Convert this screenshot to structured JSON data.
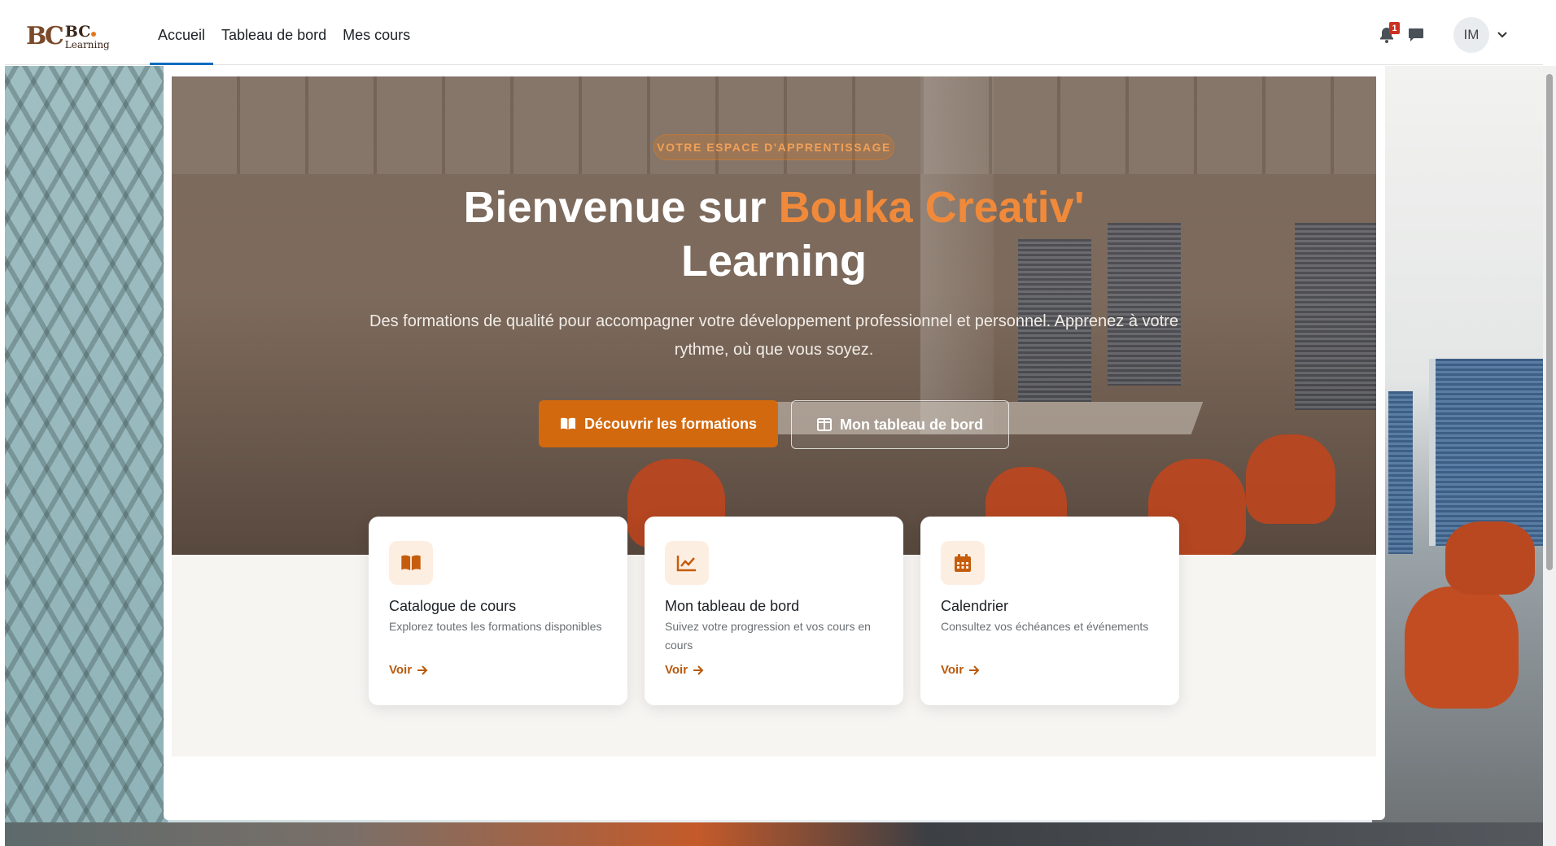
{
  "brand": {
    "logo_mark": "BC",
    "name": "BC",
    "sub": "Learning"
  },
  "nav": {
    "links": [
      {
        "label": "Accueil",
        "active": true
      },
      {
        "label": "Tableau de bord",
        "active": false
      },
      {
        "label": "Mes cours",
        "active": false
      }
    ],
    "notification_count": "1",
    "avatar_initials": "IM"
  },
  "hero": {
    "tagline": "VOTRE ESPACE D'APPRENTISSAGE",
    "title_prefix": "Bienvenue sur ",
    "title_accent": "Bouka Creativ'",
    "title_suffix": "Learning",
    "subtitle": "Des formations de qualité pour accompagner votre développement professionnel et personnel. Apprenez à votre rythme, où que vous soyez.",
    "primary_button": "Découvrir les formations",
    "secondary_button": "Mon tableau de bord"
  },
  "cards": [
    {
      "title": "Catalogue de cours",
      "description": "Explorez toutes les formations disponibles",
      "link": "Voir",
      "icon": "book-open-icon"
    },
    {
      "title": "Mon tableau de bord",
      "description": "Suivez votre progression et vos cours en cours",
      "link": "Voir",
      "icon": "chart-line-icon"
    },
    {
      "title": "Calendrier",
      "description": "Consultez vos échéances et événements",
      "link": "Voir",
      "icon": "calendar-icon"
    }
  ],
  "colors": {
    "accent": "#d2690e",
    "accent_light": "#f08a3a",
    "nav_active": "#0f6cbf",
    "badge": "#ca3120"
  }
}
